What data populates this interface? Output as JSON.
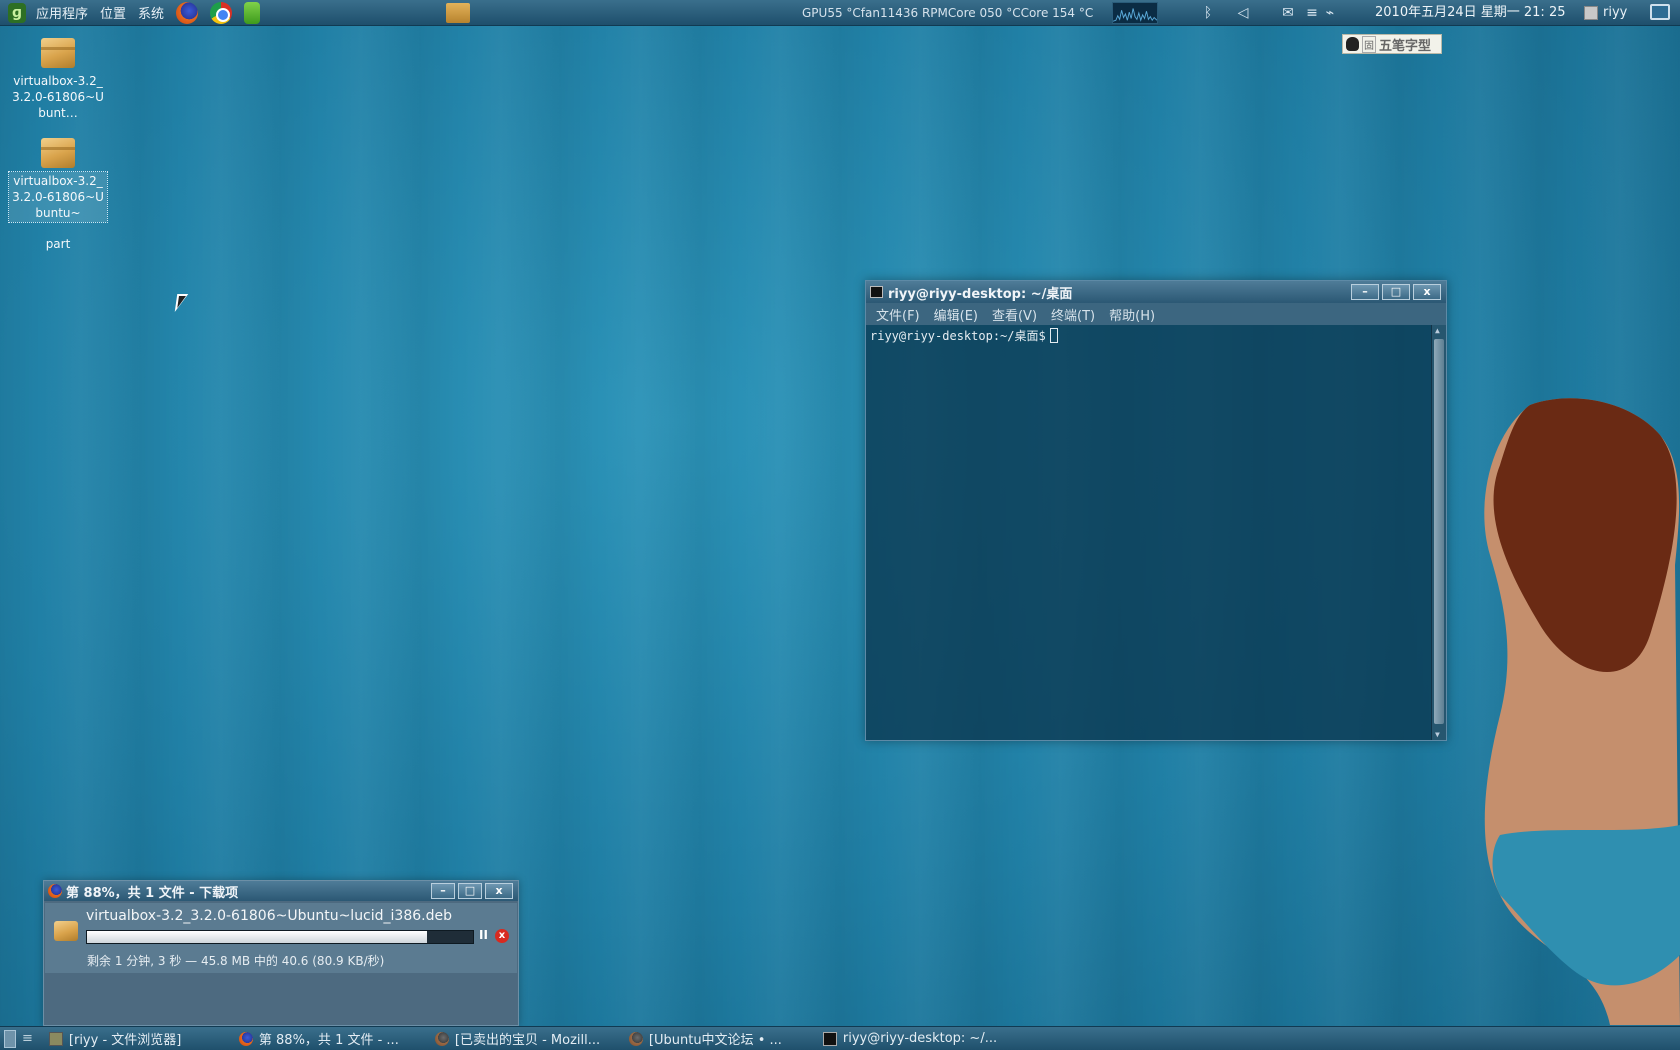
{
  "top_panel": {
    "menus": [
      "应用程序",
      "位置",
      "系统"
    ],
    "sensors_text": "GPU55 °Cfan11436 RPMCore 050 °CCore 154 °C",
    "clock": "2010年五月24日 星期一 21: 25",
    "user": "riyy"
  },
  "ime": {
    "small": "固",
    "label": "五笔字型"
  },
  "desktop": {
    "icons": [
      {
        "label": "virtualbox-3.2_3.2.0-61806~Ubunt…"
      },
      {
        "label": "virtualbox-3.2_3.2.0-61806~Ubuntu~"
      },
      {
        "label": "part"
      }
    ]
  },
  "terminal": {
    "title": "riyy@riyy-desktop: ~/桌面",
    "menu": [
      "文件(F)",
      "编辑(E)",
      "查看(V)",
      "终端(T)",
      "帮助(H)"
    ],
    "prompt": "riyy@riyy-desktop:~/桌面$",
    "btn_minimize": "–",
    "btn_maximize": "□",
    "btn_close": "x"
  },
  "downloads": {
    "title": "第 88%，共 1 文件 - 下载项",
    "file_name": "virtualbox-3.2_3.2.0-61806~Ubuntu~lucid_i386.deb",
    "progress_percent": 88,
    "status": "剩余 1 分钟, 3 秒 — 45.8 MB 中的 40.6 (80.9 KB/秒)",
    "pause_label": "II",
    "cancel_label": "x"
  },
  "taskbar": {
    "tasks": [
      {
        "label": "[riyy - 文件浏览器]",
        "icon": "folder-icon"
      },
      {
        "label": "第 88%，共 1 文件 - ...",
        "icon": "firefox-icon"
      },
      {
        "label": "[已卖出的宝贝 - Mozill...",
        "icon": "firefox-icon"
      },
      {
        "label": "[Ubuntu中文论坛 • ...",
        "icon": "firefox-icon"
      },
      {
        "label": "riyy@riyy-desktop: ~/...",
        "icon": "terminal-icon"
      }
    ]
  },
  "colors": {
    "wallpaper": "#1f7ea4",
    "panel": "#2b5f7c",
    "cancel_red": "#d82a20"
  }
}
